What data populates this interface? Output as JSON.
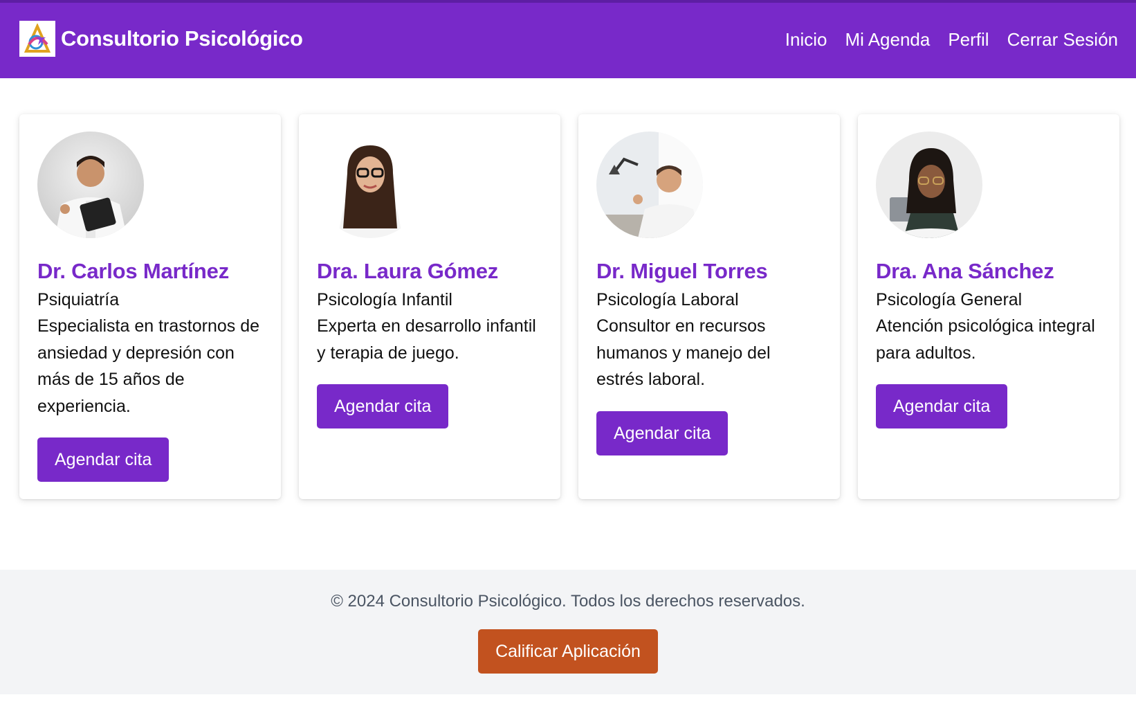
{
  "header": {
    "logo_icon": "app-logo-icon",
    "title": "Consultorio Psicológico",
    "background": "#7829c9",
    "nav": [
      "Inicio",
      "Mi Agenda",
      "Perfil",
      "Cerrar Sesión"
    ]
  },
  "doctors": [
    {
      "name": "Dr. Carlos Martínez",
      "specialty": "Psiquiatría",
      "description": "Especialista en trastornos de ansiedad y depresión con más de 15 años de experiencia.",
      "button": "Agendar cita",
      "photo_icon": "doctor-photo"
    },
    {
      "name": "Dra. Laura Gómez",
      "specialty": "Psicología Infantil",
      "description": "Experta en desarrollo infantil y terapia de juego.",
      "button": "Agendar cita",
      "photo_icon": "doctor-photo"
    },
    {
      "name": "Dr. Miguel Torres",
      "specialty": "Psicología Laboral",
      "description": "Consultor en recursos humanos y manejo del estrés laboral.",
      "button": "Agendar cita",
      "photo_icon": "doctor-photo"
    },
    {
      "name": "Dra. Ana Sánchez",
      "specialty": "Psicología General",
      "description": "Atención psicológica integral para adultos.",
      "button": "Agendar cita",
      "photo_icon": "doctor-photo"
    }
  ],
  "footer": {
    "copyright": "© 2024 Consultorio Psicológico. Todos los derechos reservados.",
    "rate_button": "Calificar Aplicación",
    "rate_button_color": "#c2521f"
  },
  "colors": {
    "accent": "#7829c9",
    "footer_bg": "#f3f4f6"
  }
}
